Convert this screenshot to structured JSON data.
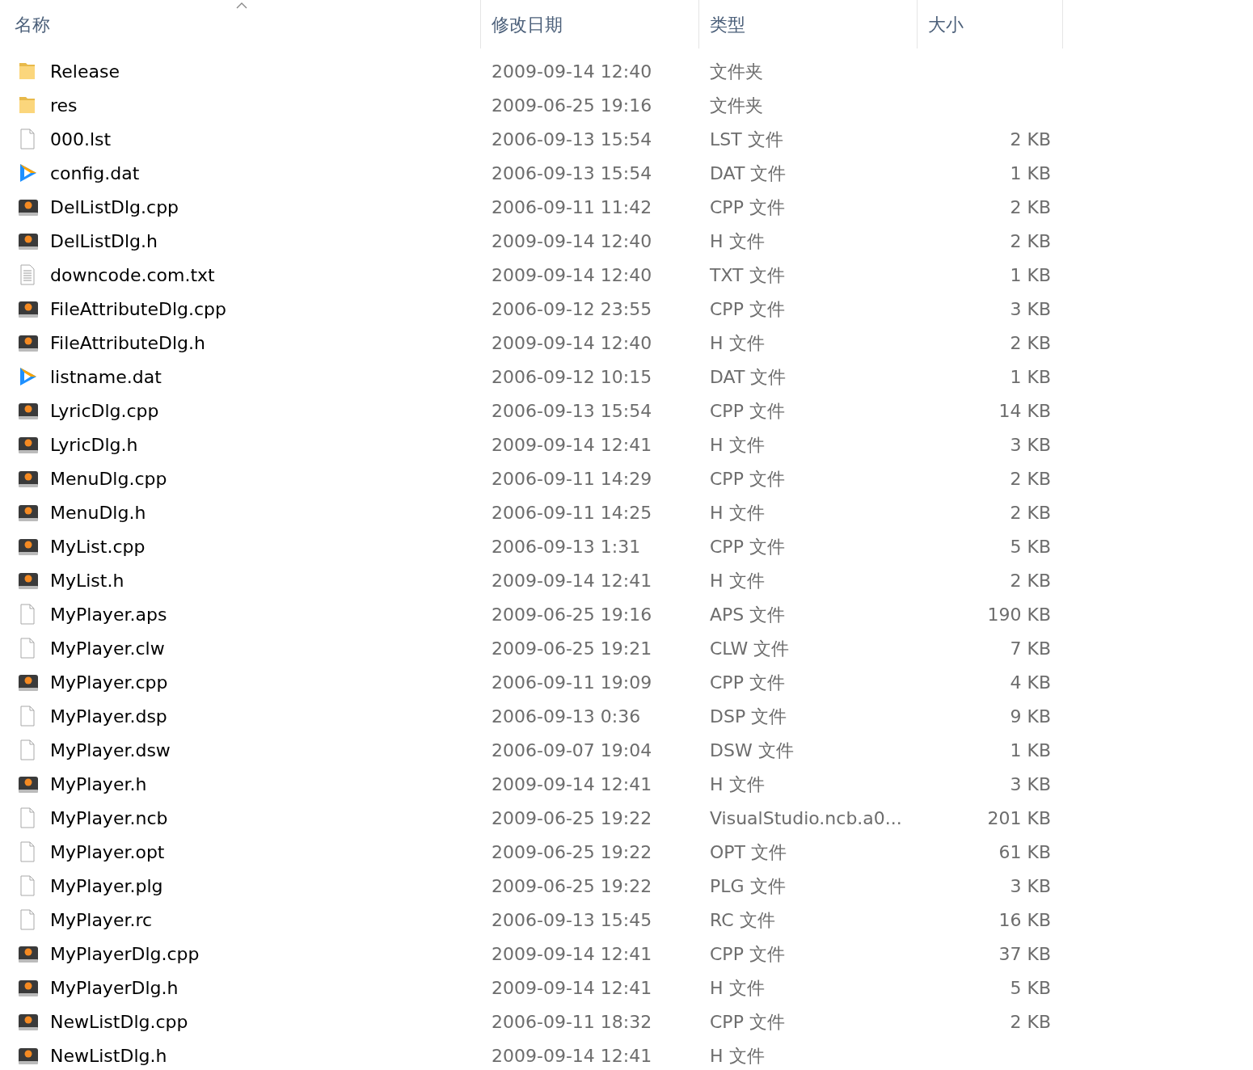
{
  "columns": [
    {
      "label": "名称",
      "sorted": true
    },
    {
      "label": "修改日期",
      "sorted": false
    },
    {
      "label": "类型",
      "sorted": false
    },
    {
      "label": "大小",
      "sorted": false
    }
  ],
  "files": [
    {
      "kind": "folder",
      "name": "Release",
      "modified": "2009-09-14 12:40",
      "type": "文件夹"
    },
    {
      "kind": "folder",
      "name": "res",
      "modified": "2009-06-25 19:16",
      "type": "文件夹"
    },
    {
      "kind": "blank",
      "name": "000.lst",
      "modified": "2006-09-13 15:54",
      "type": "LST 文件",
      "size": "2 KB"
    },
    {
      "kind": "media",
      "name": "config.dat",
      "modified": "2006-09-13 15:54",
      "type": "DAT 文件",
      "size": "1 KB"
    },
    {
      "kind": "code",
      "name": "DelListDlg.cpp",
      "modified": "2006-09-11 11:42",
      "type": "CPP 文件",
      "size": "2 KB"
    },
    {
      "kind": "code",
      "name": "DelListDlg.h",
      "modified": "2009-09-14 12:40",
      "type": "H 文件",
      "size": "2 KB"
    },
    {
      "kind": "text",
      "name": "downcode.com.txt",
      "modified": "2009-09-14 12:40",
      "type": "TXT 文件",
      "size": "1 KB"
    },
    {
      "kind": "code",
      "name": "FileAttributeDlg.cpp",
      "modified": "2006-09-12 23:55",
      "type": "CPP 文件",
      "size": "3 KB"
    },
    {
      "kind": "code",
      "name": "FileAttributeDlg.h",
      "modified": "2009-09-14 12:40",
      "type": "H 文件",
      "size": "2 KB"
    },
    {
      "kind": "media",
      "name": "listname.dat",
      "modified": "2006-09-12 10:15",
      "type": "DAT 文件",
      "size": "1 KB"
    },
    {
      "kind": "code",
      "name": "LyricDlg.cpp",
      "modified": "2006-09-13 15:54",
      "type": "CPP 文件",
      "size": "14 KB"
    },
    {
      "kind": "code",
      "name": "LyricDlg.h",
      "modified": "2009-09-14 12:41",
      "type": "H 文件",
      "size": "3 KB"
    },
    {
      "kind": "code",
      "name": "MenuDlg.cpp",
      "modified": "2006-09-11 14:29",
      "type": "CPP 文件",
      "size": "2 KB"
    },
    {
      "kind": "code",
      "name": "MenuDlg.h",
      "modified": "2006-09-11 14:25",
      "type": "H 文件",
      "size": "2 KB"
    },
    {
      "kind": "code",
      "name": "MyList.cpp",
      "modified": "2006-09-13 1:31",
      "type": "CPP 文件",
      "size": "5 KB"
    },
    {
      "kind": "code",
      "name": "MyList.h",
      "modified": "2009-09-14 12:41",
      "type": "H 文件",
      "size": "2 KB"
    },
    {
      "kind": "blank",
      "name": "MyPlayer.aps",
      "modified": "2009-06-25 19:16",
      "type": "APS 文件",
      "size": "190 KB"
    },
    {
      "kind": "blank",
      "name": "MyPlayer.clw",
      "modified": "2009-06-25 19:21",
      "type": "CLW 文件",
      "size": "7 KB"
    },
    {
      "kind": "code",
      "name": "MyPlayer.cpp",
      "modified": "2006-09-11 19:09",
      "type": "CPP 文件",
      "size": "4 KB"
    },
    {
      "kind": "blank",
      "name": "MyPlayer.dsp",
      "modified": "2006-09-13 0:36",
      "type": "DSP 文件",
      "size": "9 KB"
    },
    {
      "kind": "blank",
      "name": "MyPlayer.dsw",
      "modified": "2006-09-07 19:04",
      "type": "DSW 文件",
      "size": "1 KB"
    },
    {
      "kind": "code",
      "name": "MyPlayer.h",
      "modified": "2009-09-14 12:41",
      "type": "H 文件",
      "size": "3 KB"
    },
    {
      "kind": "blank",
      "name": "MyPlayer.ncb",
      "modified": "2009-06-25 19:22",
      "type": "VisualStudio.ncb.a0...",
      "size": "201 KB"
    },
    {
      "kind": "blank",
      "name": "MyPlayer.opt",
      "modified": "2009-06-25 19:22",
      "type": "OPT 文件",
      "size": "61 KB"
    },
    {
      "kind": "blank",
      "name": "MyPlayer.plg",
      "modified": "2009-06-25 19:22",
      "type": "PLG 文件",
      "size": "3 KB"
    },
    {
      "kind": "blank",
      "name": "MyPlayer.rc",
      "modified": "2006-09-13 15:45",
      "type": "RC 文件",
      "size": "16 KB"
    },
    {
      "kind": "code",
      "name": "MyPlayerDlg.cpp",
      "modified": "2009-09-14 12:41",
      "type": "CPP 文件",
      "size": "37 KB"
    },
    {
      "kind": "code",
      "name": "MyPlayerDlg.h",
      "modified": "2009-09-14 12:41",
      "type": "H 文件",
      "size": "5 KB"
    },
    {
      "kind": "code",
      "name": "NewListDlg.cpp",
      "modified": "2006-09-11 18:32",
      "type": "CPP 文件",
      "size": "2 KB"
    },
    {
      "kind": "code",
      "name": "NewListDlg.h",
      "modified": "2009-09-14 12:41",
      "type": "H 文件"
    }
  ]
}
